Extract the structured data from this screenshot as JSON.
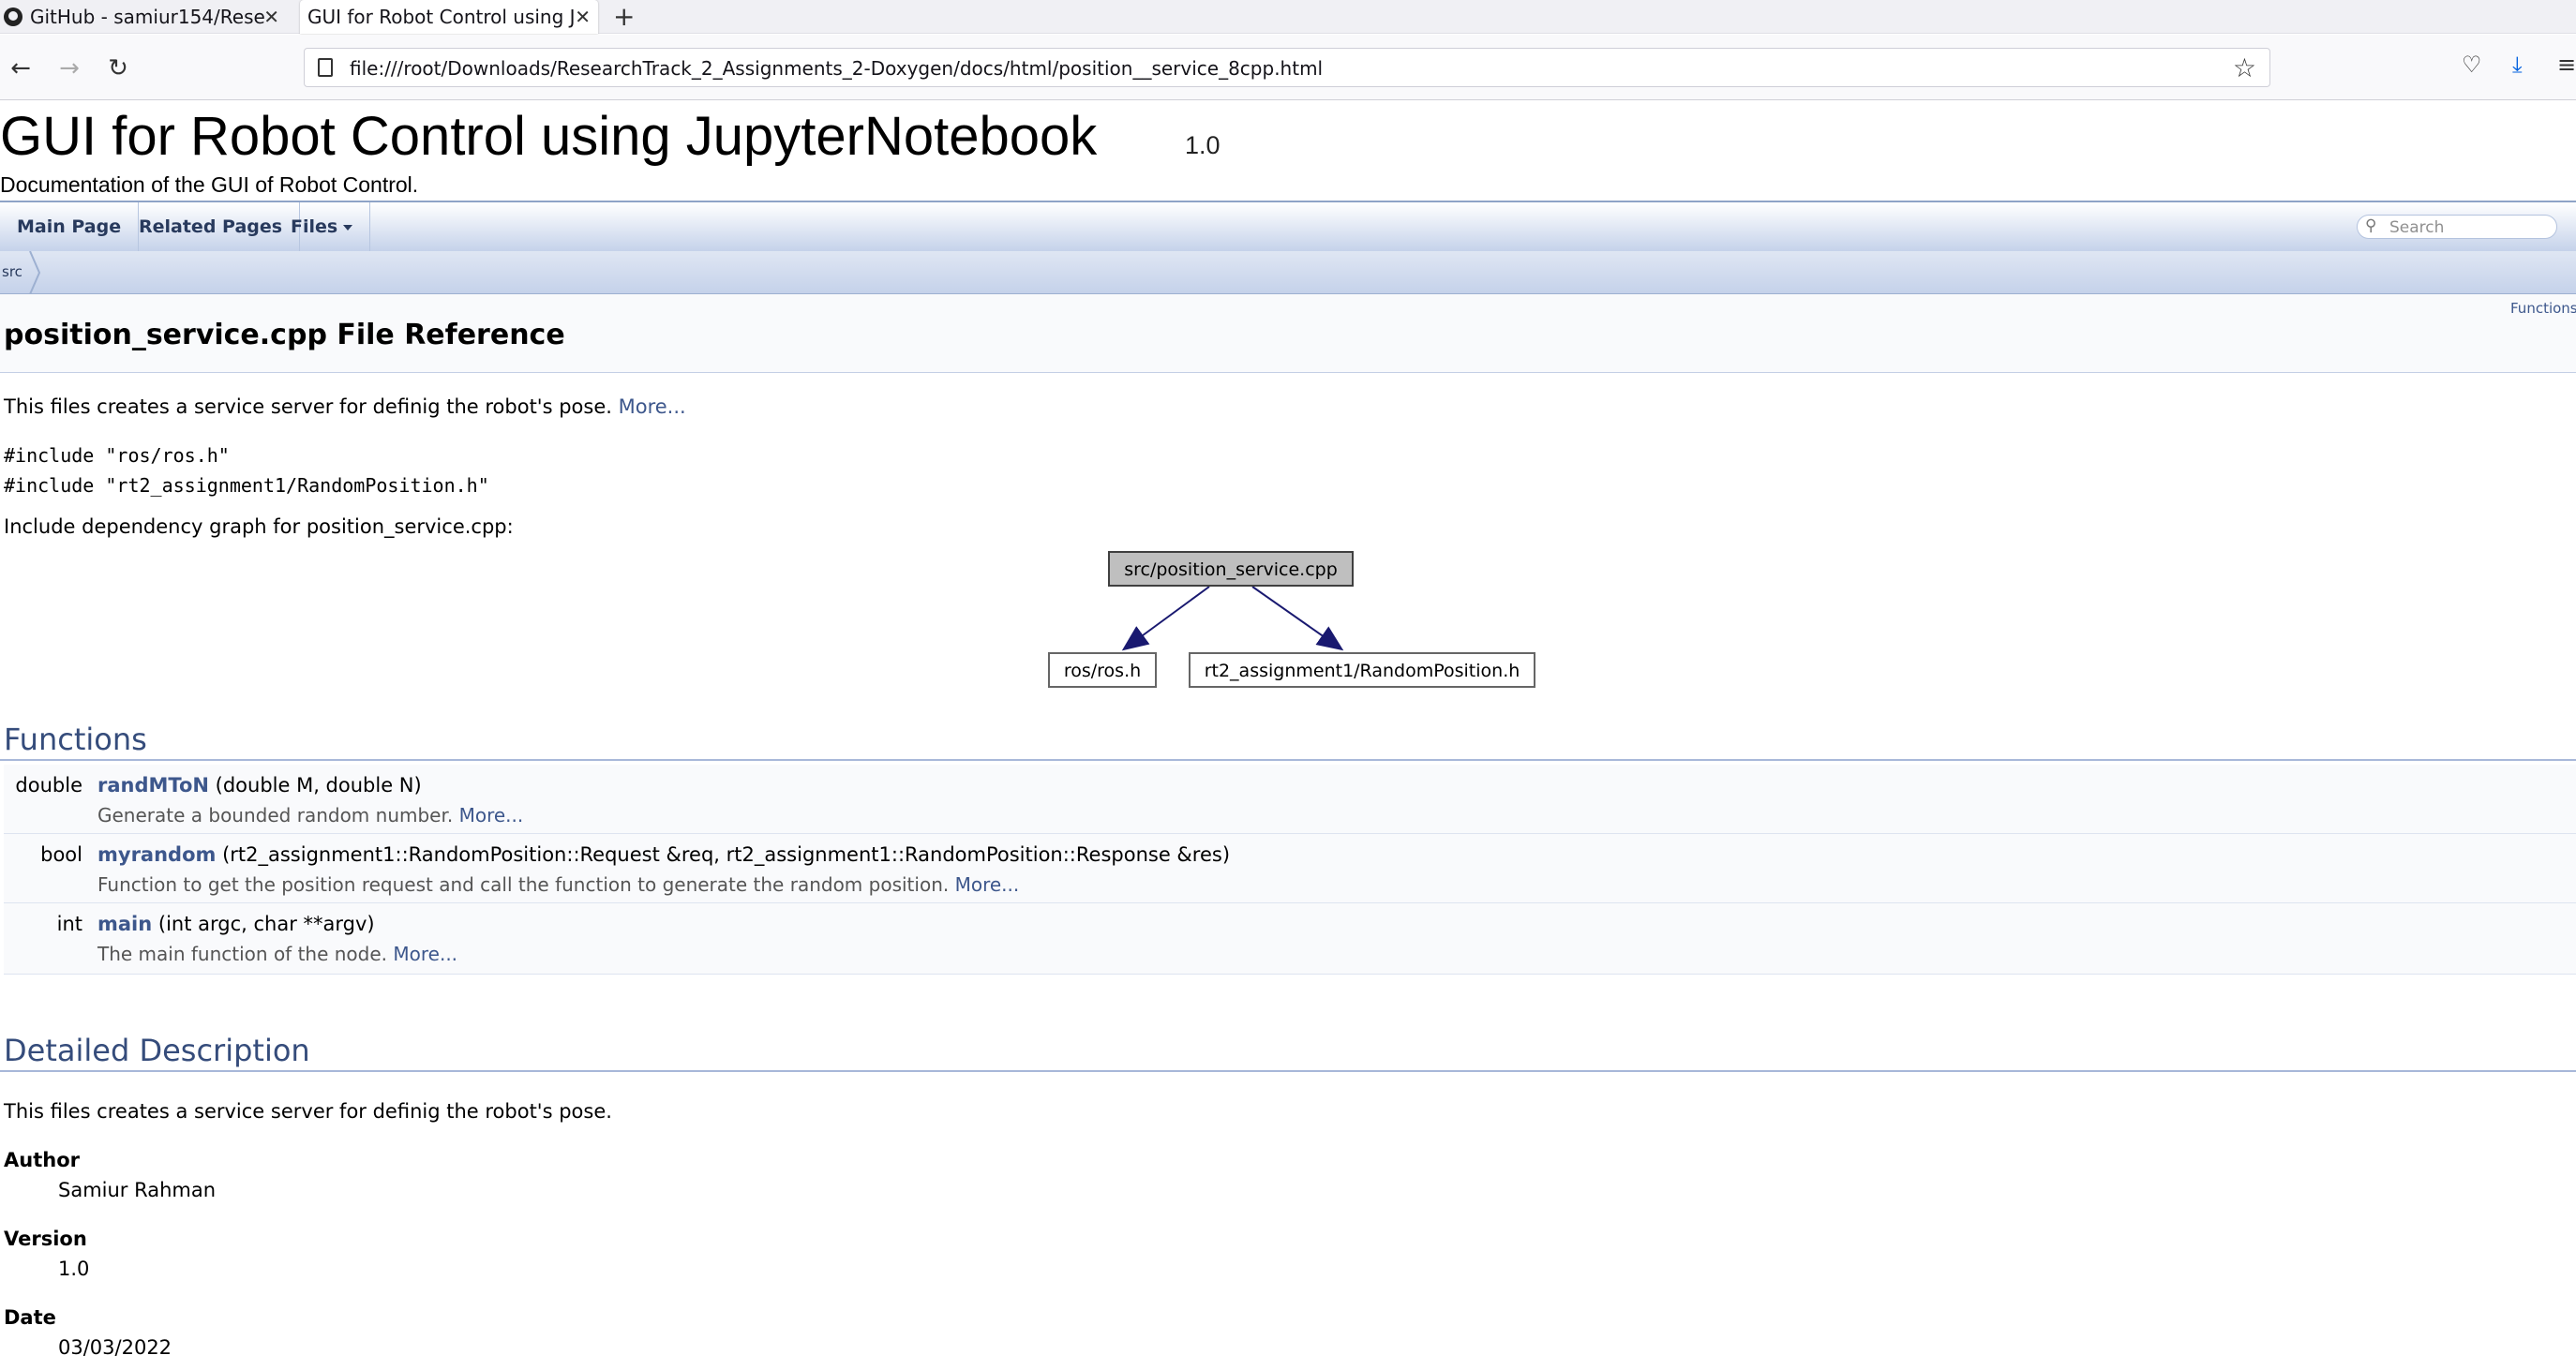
{
  "browser": {
    "tabs": [
      {
        "label": "GitHub - samiur154/Rese",
        "active": false
      },
      {
        "label": "GUI for Robot Control using J",
        "active": true
      }
    ],
    "url": "file:///root/Downloads/ResearchTrack_2_Assignments_2-Doxygen/docs/html/position__service_8cpp.html"
  },
  "project": {
    "name": "GUI for Robot Control using JupyterNotebook",
    "number": "1.0",
    "brief": "Documentation of the GUI of Robot Control."
  },
  "nav": {
    "tabs": [
      "Main Page",
      "Related Pages",
      "Files"
    ],
    "search_placeholder": "Search",
    "breadcrumb": "src",
    "summary_link": "Functions"
  },
  "page": {
    "title": "position_service.cpp File Reference",
    "brief": "This files creates a service server for definig the robot's pose.",
    "more": "More...",
    "includes": [
      "#include \"ros/ros.h\"",
      "#include \"rt2_assignment1/RandomPosition.h\""
    ],
    "graph_caption": "Include dependency graph for position_service.cpp:"
  },
  "graph": {
    "root": "src/position_service.cpp",
    "children": [
      "ros/ros.h",
      "rt2_assignment1/RandomPosition.h"
    ]
  },
  "functions": {
    "heading": "Functions",
    "items": [
      {
        "type": "double",
        "name": "randMToN",
        "args": "(double M, double N)",
        "desc": "Generate a bounded random number.",
        "more": "More..."
      },
      {
        "type": "bool",
        "name": "myrandom",
        "args": "(rt2_assignment1::RandomPosition::Request &req, rt2_assignment1::RandomPosition::Response &res)",
        "desc": "Function to get the position request and call the function to generate the random position.",
        "more": "More..."
      },
      {
        "type": "int",
        "name": "main",
        "args": "(int argc, char **argv)",
        "desc": "The main function of the node.",
        "more": "More..."
      }
    ]
  },
  "detail": {
    "heading": "Detailed Description",
    "text": "This files creates a service server for definig the robot's pose.",
    "author_label": "Author",
    "author": "Samiur Rahman",
    "version_label": "Version",
    "version": "1.0",
    "date_label": "Date",
    "date": "03/03/2022"
  }
}
